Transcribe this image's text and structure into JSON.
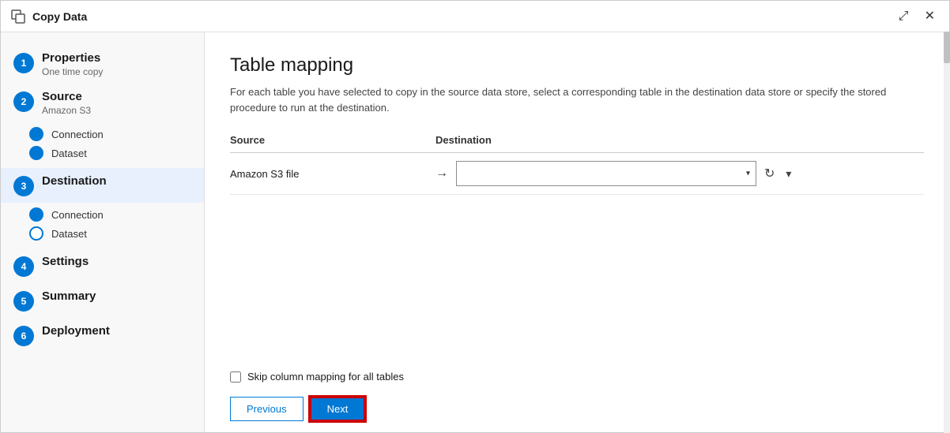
{
  "window": {
    "title": "Copy Data",
    "expand_icon": "⤢",
    "close_icon": "✕"
  },
  "sidebar": {
    "steps": [
      {
        "number": "1",
        "title": "Properties",
        "subtitle": "One time copy",
        "active": false,
        "sub_steps": []
      },
      {
        "number": "2",
        "title": "Source",
        "subtitle": "Amazon S3",
        "active": false,
        "sub_steps": [
          {
            "label": "Connection",
            "filled": true
          },
          {
            "label": "Dataset",
            "filled": true
          }
        ]
      },
      {
        "number": "3",
        "title": "Destination",
        "subtitle": "",
        "active": true,
        "sub_steps": [
          {
            "label": "Connection",
            "filled": true
          },
          {
            "label": "Dataset",
            "filled": false
          }
        ]
      },
      {
        "number": "4",
        "title": "Settings",
        "subtitle": "",
        "active": false,
        "sub_steps": []
      },
      {
        "number": "5",
        "title": "Summary",
        "subtitle": "",
        "active": false,
        "sub_steps": []
      },
      {
        "number": "6",
        "title": "Deployment",
        "subtitle": "",
        "active": false,
        "sub_steps": []
      }
    ]
  },
  "content": {
    "title": "Table mapping",
    "description": "For each table you have selected to copy in the source data store, select a corresponding table in the destination data store or specify the stored procedure to run at the destination.",
    "table": {
      "col_source": "Source",
      "col_destination": "Destination",
      "rows": [
        {
          "source_label": "Amazon S3 file",
          "destination_value": ""
        }
      ]
    },
    "skip_checkbox_label": "Skip column mapping for all tables",
    "prev_button": "Previous",
    "next_button": "Next"
  }
}
